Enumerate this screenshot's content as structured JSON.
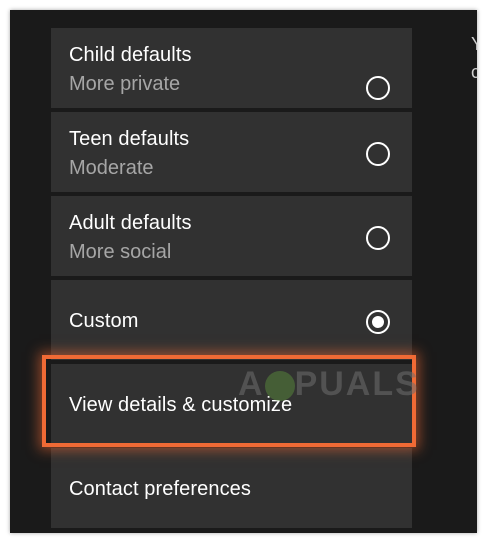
{
  "options": [
    {
      "title": "Child defaults",
      "subtitle": "More private",
      "selected": false
    },
    {
      "title": "Teen defaults",
      "subtitle": "Moderate",
      "selected": false
    },
    {
      "title": "Adult defaults",
      "subtitle": "More social",
      "selected": false
    },
    {
      "title": "Custom",
      "selected": true
    }
  ],
  "view_details_label": "View details & customize",
  "contact_preferences_label": "Contact preferences",
  "side_text": {
    "line1": "Y",
    "line2": "c"
  },
  "watermark": "APPUALS",
  "colors": {
    "background": "#1a1a1a",
    "tile": "#313131",
    "subtitle": "#a6a6a6",
    "highlight": "#f06a35"
  }
}
